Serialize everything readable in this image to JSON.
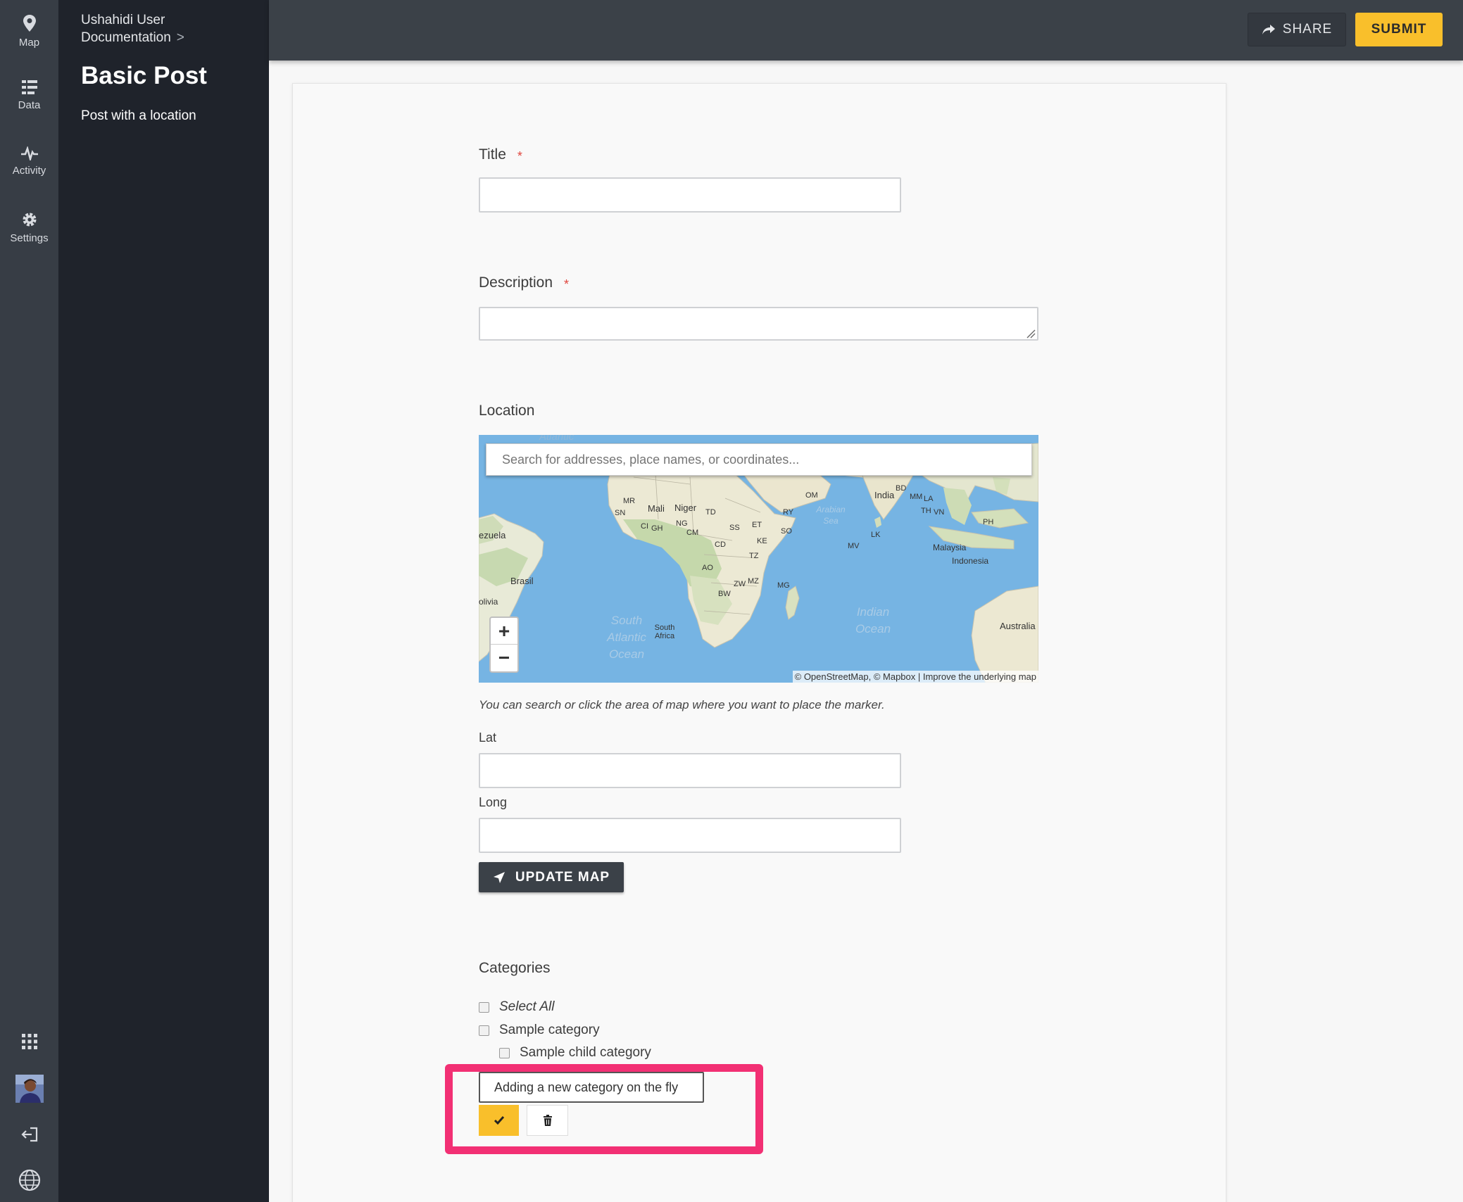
{
  "rail": {
    "items": [
      {
        "label": "Map",
        "icon": "map-pin-icon"
      },
      {
        "label": "Data",
        "icon": "data-list-icon"
      },
      {
        "label": "Activity",
        "icon": "activity-pulse-icon"
      },
      {
        "label": "Settings",
        "icon": "gear-icon"
      }
    ],
    "bottom_icons": [
      "apps-grid-icon",
      "user-avatar",
      "logout-icon",
      "ushahidi-logo-icon"
    ]
  },
  "panel": {
    "breadcrumb": "Ushahidi User Documentation",
    "breadcrumb_sep": ">",
    "title": "Basic Post",
    "subtitle": "Post with a location"
  },
  "topbar": {
    "share_label": "SHARE",
    "submit_label": "SUBMIT"
  },
  "form": {
    "title_label": "Title",
    "title_value": "",
    "required_mark": "*",
    "description_label": "Description",
    "description_value": "",
    "location_label": "Location",
    "map": {
      "search_placeholder": "Search for addresses, place names, or coordinates...",
      "zoom_in": "+",
      "zoom_out": "−",
      "attribution": "© OpenStreetMap, © Mapbox | Improve the underlying map",
      "labels": {
        "atlantic": "Atlantic",
        "south_atlantic": "South Atlantic Ocean",
        "indian": "Indian Ocean",
        "arabian": "Arabian Sea",
        "brasil": "Brasil",
        "bolivia": "olivia",
        "venezuela": "ezuela",
        "australia": "Australia",
        "indonesia": "Indonesia",
        "malaysia": "Malaysia",
        "india": "India",
        "mali": "Mali",
        "niger": "Niger",
        "south_africa": "South Africa",
        "codes": [
          "MR",
          "SN",
          "CI",
          "GH",
          "NG",
          "CM",
          "TD",
          "SS",
          "ET",
          "SO",
          "KE",
          "TZ",
          "CD",
          "AO",
          "ZW",
          "MZ",
          "BW",
          "MG",
          "RY",
          "OM",
          "LK",
          "MV",
          "BD",
          "MM",
          "LA",
          "TH",
          "VN",
          "PH"
        ]
      }
    },
    "map_hint": "You can search or click the area of map where you want to place the marker.",
    "lat_label": "Lat",
    "lat_value": "",
    "long_label": "Long",
    "long_value": "",
    "update_map_label": "UPDATE MAP",
    "categories_label": "Categories",
    "categories": [
      {
        "label": "Select All",
        "italic": true,
        "checked": false
      },
      {
        "label": "Sample category",
        "checked": false
      },
      {
        "label": "Sample child category",
        "checked": false,
        "child": true
      }
    ],
    "new_category_value": "Adding a new category on the fly"
  },
  "colors": {
    "accent": "#f9bf2b",
    "highlight": "#f23074",
    "rail": "#373d45",
    "panel": "#1f232b",
    "topbar": "#3b4148"
  }
}
